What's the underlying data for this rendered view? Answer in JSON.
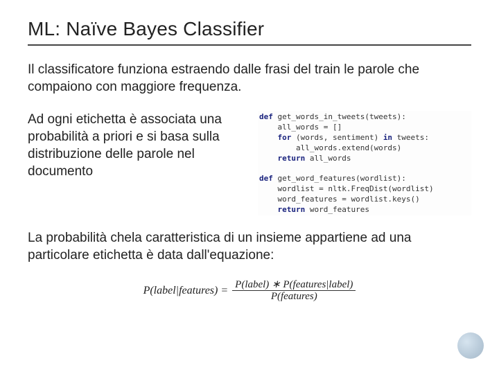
{
  "title": "ML: Naïve Bayes Classifier",
  "para1": "Il classificatore funziona estraendo dalle frasi del train le parole che compaiono con maggiore frequenza.",
  "para2": "Ad ogni etichetta è associata una probabilità a priori e si basa sulla distribuzione delle parole\n nel documento",
  "para3": "La probabilità chela caratteristica di un insieme appartiene ad una particolare etichetta è data dall'equazione:",
  "code": {
    "fn1_def": "def",
    "fn1_name": " get_words_in_tweets(tweets):",
    "fn1_l1": "    all_words = []",
    "fn1_for": "    for",
    "fn1_l2b": " (words, sentiment) ",
    "fn1_in": "in",
    "fn1_l2c": " tweets:",
    "fn1_l3": "        all_words.extend(words)",
    "fn1_ret": "    return",
    "fn1_l4b": " all_words",
    "fn2_def": "def",
    "fn2_name": " get_word_features(wordlist):",
    "fn2_l1": "    wordlist = nltk.FreqDist(wordlist)",
    "fn2_l2": "    word_features = wordlist.keys()",
    "fn2_ret": "    return",
    "fn2_l3b": " word_features"
  },
  "equation": {
    "lhs": "P(label|features) =",
    "num": "P(label) ∗ P(features|label)",
    "den": "P(features)"
  }
}
